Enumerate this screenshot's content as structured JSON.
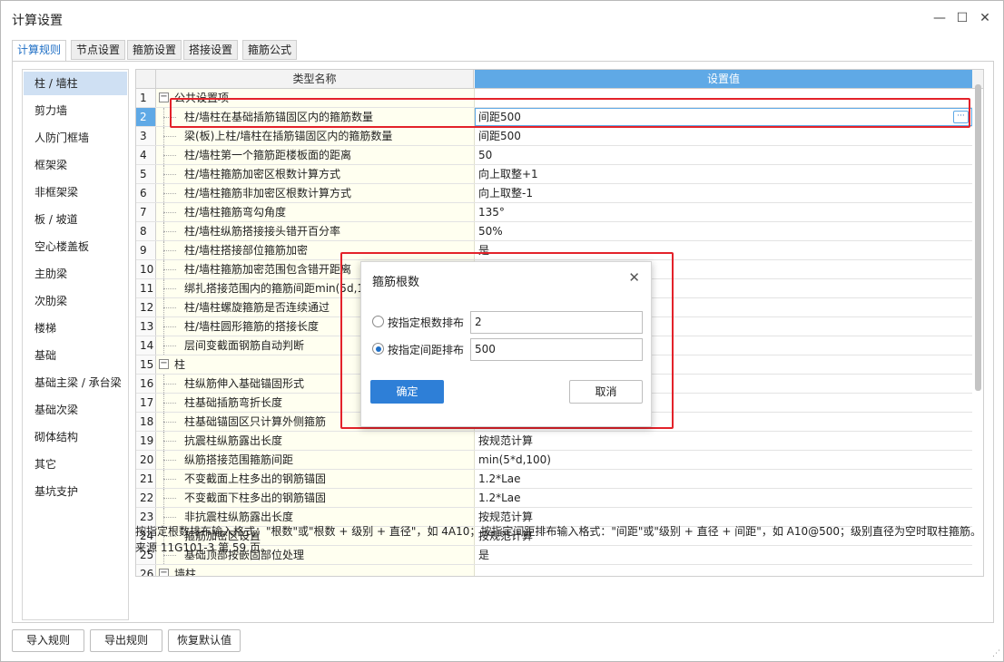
{
  "window": {
    "title": "计算设置",
    "minimize": "—",
    "maximize": "☐",
    "close": "✕"
  },
  "tabs": [
    "计算规则",
    "节点设置",
    "箍筋设置",
    "搭接设置",
    "箍筋公式"
  ],
  "active_tab": 0,
  "sidebar": {
    "items": [
      "柱 / 墙柱",
      "剪力墙",
      "人防门框墙",
      "框架梁",
      "非框架梁",
      "板 / 坡道",
      "空心楼盖板",
      "主肋梁",
      "次肋梁",
      "楼梯",
      "基础",
      "基础主梁 / 承台梁",
      "基础次梁",
      "砌体结构",
      "其它",
      "基坑支护"
    ],
    "active": 0
  },
  "grid": {
    "col_name": "类型名称",
    "col_value": "设置值",
    "rows": [
      {
        "n": "1",
        "name": "公共设置项",
        "value": "",
        "group": true
      },
      {
        "n": "2",
        "name": "柱/墙柱在基础插筋锚固区内的箍筋数量",
        "value": "间距500",
        "selected": true
      },
      {
        "n": "3",
        "name": "梁(板)上柱/墙柱在插筋锚固区内的箍筋数量",
        "value": "间距500"
      },
      {
        "n": "4",
        "name": "柱/墙柱第一个箍筋距楼板面的距离",
        "value": "50"
      },
      {
        "n": "5",
        "name": "柱/墙柱箍筋加密区根数计算方式",
        "value": "向上取整+1"
      },
      {
        "n": "6",
        "name": "柱/墙柱箍筋非加密区根数计算方式",
        "value": "向上取整-1"
      },
      {
        "n": "7",
        "name": "柱/墙柱箍筋弯勾角度",
        "value": "135°"
      },
      {
        "n": "8",
        "name": "柱/墙柱纵筋搭接接头错开百分率",
        "value": "50%"
      },
      {
        "n": "9",
        "name": "柱/墙柱搭接部位箍筋加密",
        "value": "是"
      },
      {
        "n": "10",
        "name": "柱/墙柱箍筋加密范围包含错开距离",
        "value": ""
      },
      {
        "n": "11",
        "name": "绑扎搭接范围内的箍筋间距min(5d,1",
        "value": ""
      },
      {
        "n": "12",
        "name": "柱/墙柱螺旋箍筋是否连续通过",
        "value": ""
      },
      {
        "n": "13",
        "name": "柱/墙柱圆形箍筋的搭接长度",
        "value": ""
      },
      {
        "n": "14",
        "name": "层间变截面钢筋自动判断",
        "value": ""
      },
      {
        "n": "15",
        "name": "柱",
        "value": "",
        "group": true
      },
      {
        "n": "16",
        "name": "柱纵筋伸入基础锚固形式",
        "value": ""
      },
      {
        "n": "17",
        "name": "柱基础插筋弯折长度",
        "value": ""
      },
      {
        "n": "18",
        "name": "柱基础锚固区只计算外侧箍筋",
        "value": ""
      },
      {
        "n": "19",
        "name": "抗震柱纵筋露出长度",
        "value": "按规范计算"
      },
      {
        "n": "20",
        "name": "纵筋搭接范围箍筋间距",
        "value": "min(5*d,100)"
      },
      {
        "n": "21",
        "name": "不变截面上柱多出的钢筋锚固",
        "value": "1.2*Lae"
      },
      {
        "n": "22",
        "name": "不变截面下柱多出的钢筋锚固",
        "value": "1.2*Lae"
      },
      {
        "n": "23",
        "name": "非抗震柱纵筋露出长度",
        "value": "按规范计算"
      },
      {
        "n": "24",
        "name": "箍筋加密区设置",
        "value": "按规范计算"
      },
      {
        "n": "25",
        "name": "基础顶部按嵌固部位处理",
        "value": "是"
      },
      {
        "n": "26",
        "name": "墙柱",
        "value": "",
        "group": true
      }
    ],
    "ellipsis": "···"
  },
  "note": "按指定根数排布输入格式：\"根数\"或\"根数 + 级别 + 直径\"，如 4A10；按指定间距排布输入格式：\"间距\"或\"级别 + 直径 + 间距\"，如 A10@500；级别直径为空时取柱箍筋。来源 11G101-3 第 59 页。",
  "bottom_buttons": [
    "导入规则",
    "导出规则",
    "恢复默认值"
  ],
  "dialog": {
    "title": "箍筋根数",
    "close": "✕",
    "option_count_label": "按指定根数排布",
    "option_count_value": "2",
    "option_spacing_label": "按指定间距排布",
    "option_spacing_value": "500",
    "selected_option": "spacing",
    "ok": "确定",
    "cancel": "取消"
  },
  "colors": {
    "accent": "#2e7fd7",
    "header_value_bg": "#5fa9e6",
    "highlight_box": "#e3222a",
    "name_cell_bg": "#fffff0"
  }
}
